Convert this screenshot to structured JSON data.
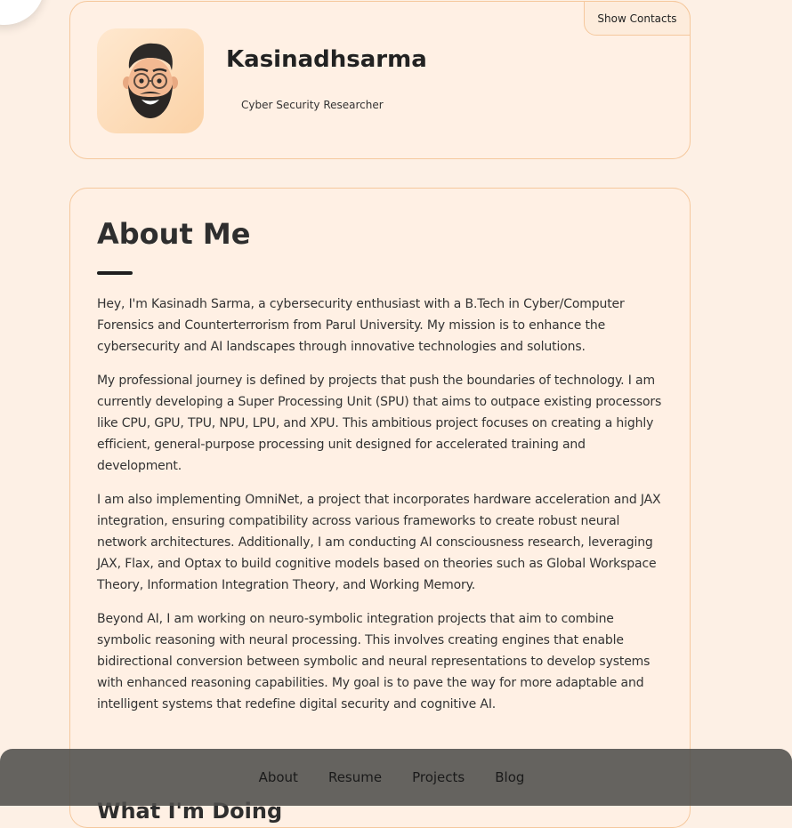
{
  "profile": {
    "name": "Kasinadhsarma",
    "role": "Cyber Security Researcher",
    "contacts_button": "Show Contacts"
  },
  "about": {
    "title": "About Me",
    "paragraphs": [
      "Hey, I'm Kasinadh Sarma, a cybersecurity enthusiast with a B.Tech in Cyber/Computer Forensics and Counterterrorism from Parul University. My mission is to enhance the cybersecurity and AI landscapes through innovative technologies and solutions.",
      "My professional journey is defined by projects that push the boundaries of technology. I am currently developing a Super Processing Unit (SPU) that aims to outpace existing processors like CPU, GPU, TPU, NPU, LPU, and XPU. This ambitious project focuses on creating a highly efficient, general-purpose processing unit designed for accelerated training and development.",
      "I am also implementing OmniNet, a project that incorporates hardware acceleration and JAX integration, ensuring compatibility across various frameworks to create robust neural network architectures. Additionally, I am conducting AI consciousness research, leveraging JAX, Flax, and Optax to build cognitive models based on theories such as Global Workspace Theory, Information Integration Theory, and Working Memory.",
      "Beyond AI, I am working on neuro-symbolic integration projects that aim to combine symbolic reasoning with neural processing. This involves creating engines that enable bidirectional conversion between symbolic and neural representations to develop systems with enhanced reasoning capabilities. My goal is to pave the way for more adaptable and intelligent systems that redefine digital security and cognitive AI."
    ],
    "next_heading": "What I'm Doing"
  },
  "nav": {
    "items": [
      "About",
      "Resume",
      "Projects",
      "Blog"
    ]
  },
  "icons": {
    "avatar": "memoji-avatar-icon"
  },
  "colors": {
    "background": "#fdf0e5",
    "card": "#fff0e4",
    "card_border": "#f5c89d",
    "nav_bar": "#504e4c"
  }
}
